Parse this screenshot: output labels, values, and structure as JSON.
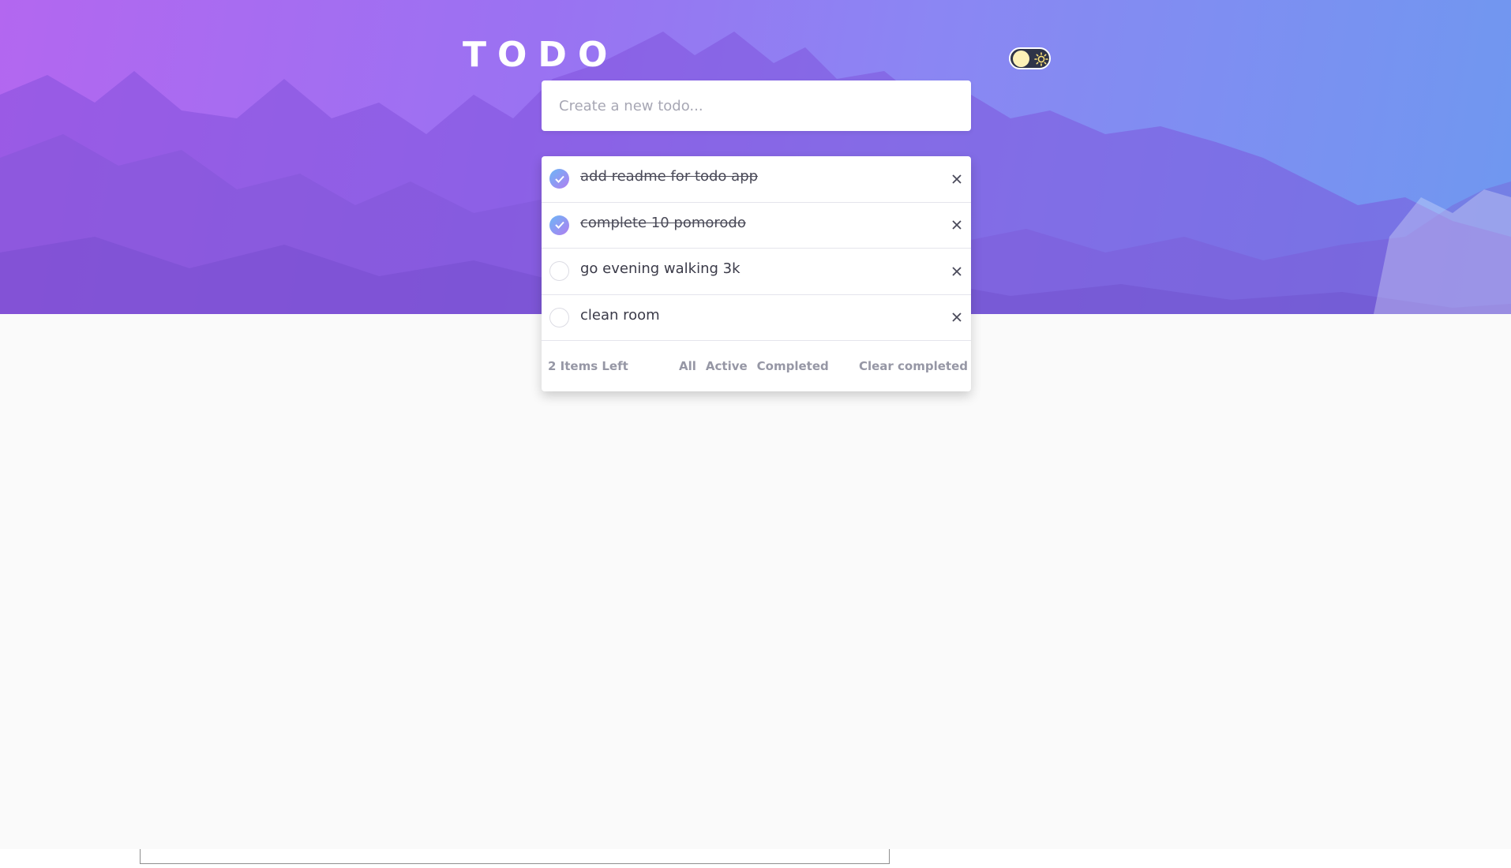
{
  "app": {
    "title": "TODO"
  },
  "new_todo": {
    "placeholder": "Create a new todo..."
  },
  "todos": [
    {
      "text": "add readme for todo app",
      "completed": true
    },
    {
      "text": "complete 10 pomorodo",
      "completed": true
    },
    {
      "text": "go evening walking 3k",
      "completed": false
    },
    {
      "text": "clean room",
      "completed": false
    }
  ],
  "footer": {
    "items_left": "2 Items Left",
    "filters": [
      "All",
      "Active",
      "Completed"
    ],
    "clear_label": "Clear completed"
  },
  "icons": {
    "theme_toggle": "sun-icon",
    "check": "check-icon",
    "delete": "close-icon"
  },
  "colors": {
    "accent_from": "#6cb6f6",
    "accent_to": "#b07ef0",
    "hero_from": "#b367f0",
    "hero_to": "#6f98f0"
  }
}
